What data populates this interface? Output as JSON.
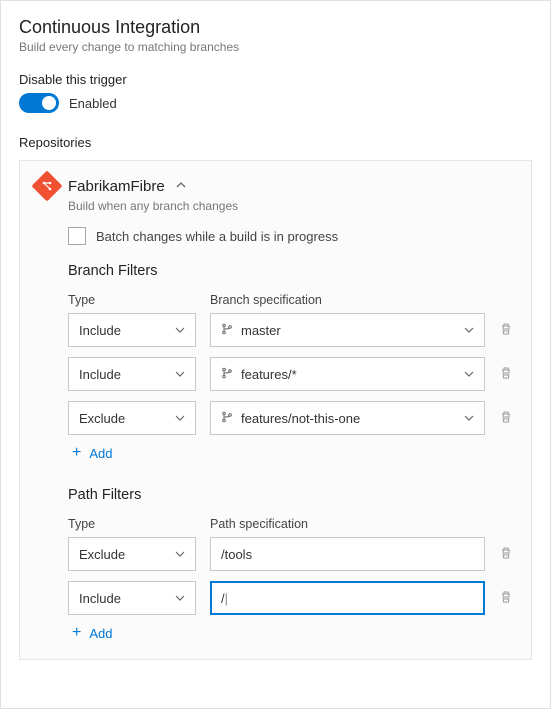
{
  "header": {
    "title": "Continuous Integration",
    "subtitle": "Build every change to matching branches"
  },
  "trigger": {
    "disable_label": "Disable this trigger",
    "state_label": "Enabled"
  },
  "repositories": {
    "section_label": "Repositories",
    "repo": {
      "name": "FabrikamFibre",
      "subtitle": "Build when any branch changes",
      "batch_label": "Batch changes while a build is in progress"
    }
  },
  "branch_filters": {
    "title": "Branch Filters",
    "type_header": "Type",
    "spec_header": "Branch specification",
    "rows": [
      {
        "type": "Include",
        "spec": "master"
      },
      {
        "type": "Include",
        "spec": "features/*"
      },
      {
        "type": "Exclude",
        "spec": "features/not-this-one"
      }
    ],
    "add_label": "Add"
  },
  "path_filters": {
    "title": "Path Filters",
    "type_header": "Type",
    "spec_header": "Path specification",
    "rows": [
      {
        "type": "Exclude",
        "spec": "/tools"
      },
      {
        "type": "Include",
        "spec": "/"
      }
    ],
    "add_label": "Add"
  }
}
